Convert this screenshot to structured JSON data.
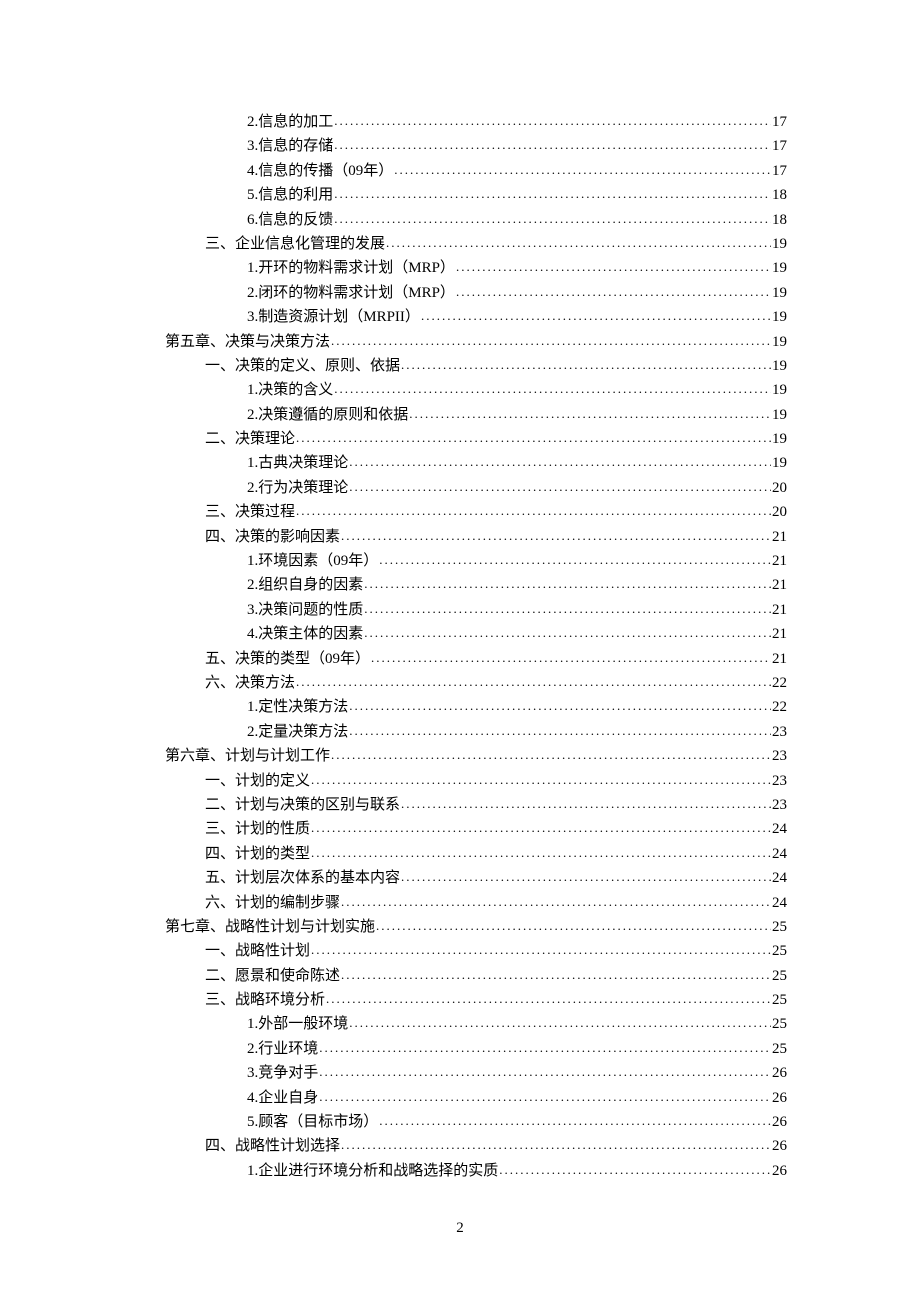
{
  "page_number": "2",
  "toc": [
    {
      "indent": 2,
      "label": "2.信息的加工",
      "page": "17"
    },
    {
      "indent": 2,
      "label": "3.信息的存储",
      "page": "17"
    },
    {
      "indent": 2,
      "label": "4.信息的传播（09年）",
      "page": "17"
    },
    {
      "indent": 2,
      "label": "5.信息的利用",
      "page": "18"
    },
    {
      "indent": 2,
      "label": "6.信息的反馈",
      "page": "18"
    },
    {
      "indent": 1,
      "label": "三、企业信息化管理的发展",
      "page": "19"
    },
    {
      "indent": 2,
      "label": "1.开环的物料需求计划（MRP）",
      "page": "19"
    },
    {
      "indent": 2,
      "label": "2.闭环的物料需求计划（MRP）",
      "page": "19"
    },
    {
      "indent": 2,
      "label": "3.制造资源计划（MRPII）",
      "page": "19"
    },
    {
      "indent": 0,
      "label": "第五章、决策与决策方法",
      "page": "19"
    },
    {
      "indent": 1,
      "label": "一、决策的定义、原则、依据",
      "page": "19"
    },
    {
      "indent": 2,
      "label": "1.决策的含义",
      "page": "19"
    },
    {
      "indent": 2,
      "label": "2.决策遵循的原则和依据",
      "page": "19"
    },
    {
      "indent": 1,
      "label": "二、决策理论",
      "page": "19"
    },
    {
      "indent": 2,
      "label": "1.古典决策理论",
      "page": "19"
    },
    {
      "indent": 2,
      "label": "2.行为决策理论",
      "page": "20"
    },
    {
      "indent": 1,
      "label": "三、决策过程",
      "page": "20"
    },
    {
      "indent": 1,
      "label": "四、决策的影响因素",
      "page": "21"
    },
    {
      "indent": 2,
      "label": "1.环境因素（09年）",
      "page": "21"
    },
    {
      "indent": 2,
      "label": "2.组织自身的因素",
      "page": "21"
    },
    {
      "indent": 2,
      "label": "3.决策问题的性质",
      "page": "21"
    },
    {
      "indent": 2,
      "label": "4.决策主体的因素",
      "page": "21"
    },
    {
      "indent": 1,
      "label": "五、决策的类型（09年）",
      "page": "21"
    },
    {
      "indent": 1,
      "label": "六、决策方法",
      "page": "22"
    },
    {
      "indent": 2,
      "label": "1.定性决策方法",
      "page": "22"
    },
    {
      "indent": 2,
      "label": "2.定量决策方法",
      "page": "23"
    },
    {
      "indent": 0,
      "label": "第六章、计划与计划工作",
      "page": "23"
    },
    {
      "indent": 1,
      "label": "一、计划的定义",
      "page": "23"
    },
    {
      "indent": 1,
      "label": "二、计划与决策的区别与联系",
      "page": "23"
    },
    {
      "indent": 1,
      "label": "三、计划的性质",
      "page": "24"
    },
    {
      "indent": 1,
      "label": "四、计划的类型",
      "page": "24"
    },
    {
      "indent": 1,
      "label": "五、计划层次体系的基本内容",
      "page": "24"
    },
    {
      "indent": 1,
      "label": "六、计划的编制步骤",
      "page": "24"
    },
    {
      "indent": 0,
      "label": "第七章、战略性计划与计划实施",
      "page": "25"
    },
    {
      "indent": 1,
      "label": "一、战略性计划",
      "page": "25"
    },
    {
      "indent": 1,
      "label": "二、愿景和使命陈述",
      "page": "25"
    },
    {
      "indent": 1,
      "label": "三、战略环境分析",
      "page": "25"
    },
    {
      "indent": 2,
      "label": "1.外部一般环境",
      "page": "25"
    },
    {
      "indent": 2,
      "label": "2.行业环境",
      "page": "25"
    },
    {
      "indent": 2,
      "label": "3.竞争对手",
      "page": "26"
    },
    {
      "indent": 2,
      "label": "4.企业自身",
      "page": "26"
    },
    {
      "indent": 2,
      "label": "5.顾客（目标市场）",
      "page": "26"
    },
    {
      "indent": 1,
      "label": "四、战略性计划选择",
      "page": "26"
    },
    {
      "indent": 2,
      "label": "1.企业进行环境分析和战略选择的实质",
      "page": "26"
    }
  ]
}
